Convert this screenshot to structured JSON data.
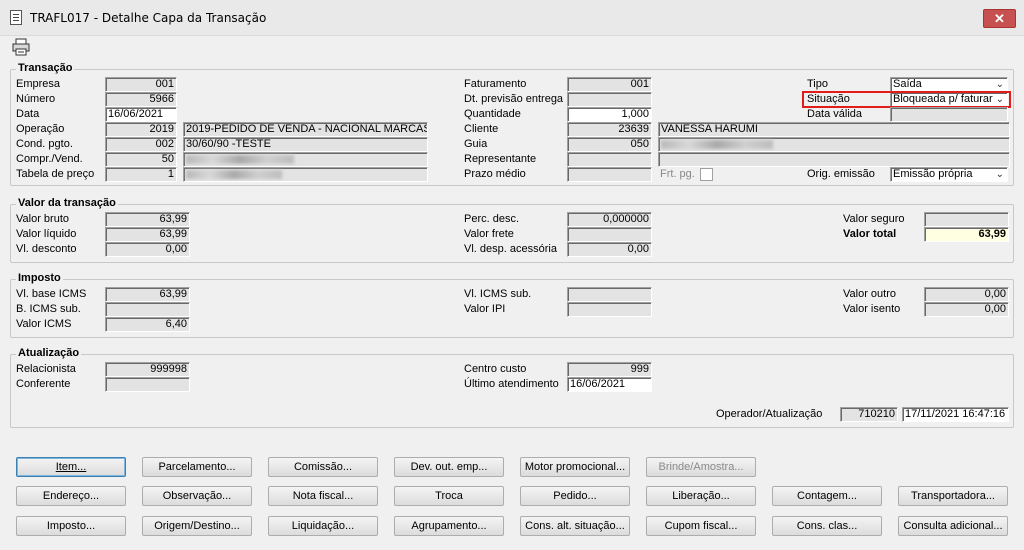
{
  "window": {
    "title": "TRAFL017 - Detalhe Capa da Transação",
    "close": "✕"
  },
  "toolbar": {
    "print_icon": "printer-icon"
  },
  "transacao": {
    "title": "Transação",
    "empresa": {
      "label": "Empresa",
      "value": "001"
    },
    "numero": {
      "label": "Número",
      "value": "5966"
    },
    "data": {
      "label": "Data",
      "value": "16/06/2021"
    },
    "operacao": {
      "label": "Operação",
      "code": "2019",
      "desc": "2019-PEDIDO DE VENDA - NACIONAL MARCAS"
    },
    "cond_pgto": {
      "label": "Cond. pgto.",
      "code": "002",
      "desc": "30/60/90 -TESTE"
    },
    "compr_vend": {
      "label": "Compr./Vend.",
      "code": "50"
    },
    "tabela_preco": {
      "label": "Tabela de preço",
      "code": "1"
    },
    "faturamento": {
      "label": "Faturamento",
      "value": "001"
    },
    "dt_previsao": {
      "label": "Dt. previsão entrega",
      "value": ""
    },
    "quantidade": {
      "label": "Quantidade",
      "value": "1,000"
    },
    "cliente": {
      "label": "Cliente",
      "code": "23639",
      "name": "VANESSA HARUMI"
    },
    "guia": {
      "label": "Guia",
      "code": "050"
    },
    "representante": {
      "label": "Representante",
      "value": ""
    },
    "prazo_medio": {
      "label": "Prazo médio",
      "value": ""
    },
    "frt_pg": {
      "label": "Frt. pg."
    },
    "tipo": {
      "label": "Tipo",
      "value": "Saída"
    },
    "situacao": {
      "label": "Situação",
      "value": "Bloqueada p/ faturar"
    },
    "data_valida": {
      "label": "Data válida",
      "value": ""
    },
    "orig_emissao": {
      "label": "Orig. emissão",
      "value": "Emissão própria"
    }
  },
  "valor": {
    "title": "Valor da transação",
    "bruto": {
      "label": "Valor bruto",
      "value": "63,99"
    },
    "liquido": {
      "label": "Valor líquido",
      "value": "63,99"
    },
    "desconto": {
      "label": "Vl. desconto",
      "value": "0,00"
    },
    "perc_desc": {
      "label": "Perc. desc.",
      "value": "0,000000"
    },
    "frete": {
      "label": "Valor frete",
      "value": ""
    },
    "desp_acessoria": {
      "label": "Vl. desp. acessória",
      "value": "0,00"
    },
    "seguro": {
      "label": "Valor seguro",
      "value": ""
    },
    "total": {
      "label": "Valor total",
      "value": "63,99"
    }
  },
  "imposto": {
    "title": "Imposto",
    "base_icms": {
      "label": "Vl. base ICMS",
      "value": "63,99"
    },
    "b_icms_sub": {
      "label": "B. ICMS sub.",
      "value": ""
    },
    "valor_icms": {
      "label": "Valor ICMS",
      "value": "6,40"
    },
    "icms_sub": {
      "label": "Vl. ICMS sub.",
      "value": ""
    },
    "valor_ipi": {
      "label": "Valor IPI",
      "value": ""
    },
    "outro": {
      "label": "Valor outro",
      "value": "0,00"
    },
    "isento": {
      "label": "Valor isento",
      "value": "0,00"
    }
  },
  "atualizacao": {
    "title": "Atualização",
    "relacionista": {
      "label": "Relacionista",
      "value": "999998"
    },
    "conferente": {
      "label": "Conferente",
      "value": ""
    },
    "centro_custo": {
      "label": "Centro custo",
      "value": "999"
    },
    "ultimo_atendimento": {
      "label": "Último atendimento",
      "value": "16/06/2021"
    },
    "operador": {
      "label": "Operador/Atualização",
      "code": "710210",
      "datetime": "17/11/2021 16:47:16"
    }
  },
  "buttons": {
    "row1": [
      "Item...",
      "Parcelamento...",
      "Comissão...",
      "Dev. out. emp...",
      "Motor promocional...",
      "Brinde/Amostra..."
    ],
    "row2": [
      "Endereço...",
      "Observação...",
      "Nota fiscal...",
      "Troca",
      "Pedido...",
      "Liberação...",
      "Contagem...",
      "Transportadora..."
    ],
    "row3": [
      "Imposto...",
      "Origem/Destino...",
      "Liquidação...",
      "Agrupamento...",
      "Cons. alt. situação...",
      "Cupom fiscal...",
      "Cons. clas...",
      "Consulta adicional..."
    ]
  }
}
